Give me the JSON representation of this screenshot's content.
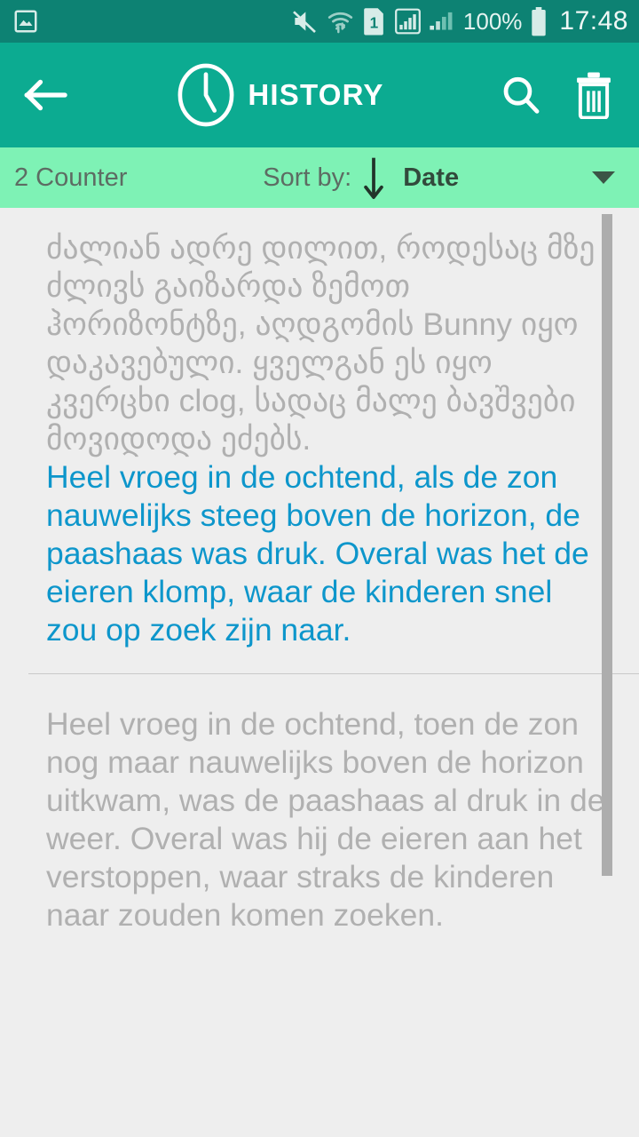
{
  "status_bar": {
    "background": "#0d8273",
    "left_icons": [
      {
        "name": "gallery-image-icon",
        "label": "image"
      }
    ],
    "right_icons": [
      {
        "name": "mute-icon",
        "label": "sound off"
      },
      {
        "name": "wifi-transfer-icon",
        "label": "wifi"
      },
      {
        "name": "sim-1-icon",
        "label": "1"
      },
      {
        "name": "signal-boxed-icon",
        "label": "signal 1"
      },
      {
        "name": "signal-bars-icon",
        "label": "signal 2"
      }
    ],
    "battery_percent": "100%",
    "battery_icon": "battery-full-icon",
    "clock": "17:48"
  },
  "app_bar": {
    "background": "#0cab91",
    "back_icon": "arrow-left-icon",
    "clock_icon": "clock-icon",
    "title": "HISTORY",
    "search_icon": "search-icon",
    "delete_icon": "trash-icon"
  },
  "sort_bar": {
    "background": "#7ef2b5",
    "counter": "2 Counter",
    "sort_label": "Sort by:",
    "sort_direction_icon": "arrow-down-icon",
    "sort_value": "Date",
    "dropdown_icon": "chevron-down-icon"
  },
  "history": {
    "scrollbar": {
      "name": "vertical-scrollbar"
    },
    "entries": [
      {
        "source_text": "ძალიან ადრე დილით, როდესაც მზე ძლივს გაიზარდა ზემოთ ჰორიზონტზე, აღდგომის Bunny იყო დაკავებული. ყველგან ეს იყო კვერცხი clog, სადაც მალე ბავშვები მოვიდოდა ეძებს.",
        "target_text": "Heel vroeg in de ochtend, als de zon nauwelijks steeg boven de horizon, de paashaas was druk. Overal was het de eieren klomp, waar de kinderen snel zou op zoek zijn naar.",
        "target_color": "#0d96cb"
      },
      {
        "source_text": "Heel vroeg in de ochtend, toen de zon nog maar nauwelijks boven de horizon uitkwam, was de paashaas al druk in de weer. Overal was hij de eieren aan het verstoppen, waar straks de kinderen\nnaar zouden komen zoeken.",
        "target_text": "",
        "target_color": "#0d96cb"
      }
    ]
  }
}
